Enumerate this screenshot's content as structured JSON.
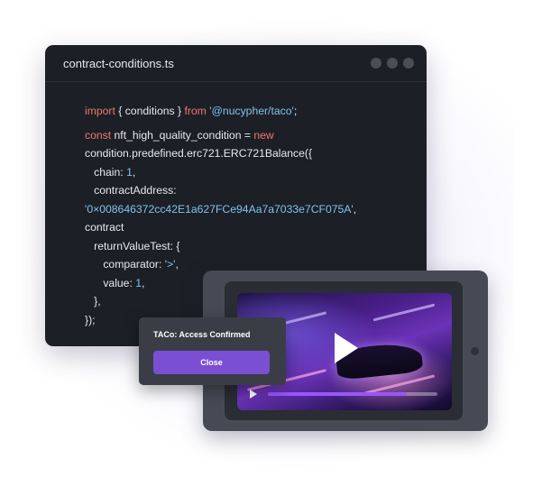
{
  "editor": {
    "file_name": "contract-conditions.ts",
    "lines": [
      [
        {
          "t": "import",
          "c": "kw"
        },
        {
          "t": " { conditions } ",
          "c": ""
        },
        {
          "t": "from",
          "c": "kw"
        },
        {
          "t": " ",
          "c": ""
        },
        {
          "t": "'@nucypher/taco'",
          "c": "str"
        },
        {
          "t": ";",
          "c": ""
        }
      ],
      [
        {
          "t": "const",
          "c": "kw"
        },
        {
          "t": " nft_high_quality_condition = ",
          "c": ""
        },
        {
          "t": "new",
          "c": "kw"
        }
      ],
      [
        {
          "t": "condition.predefined.erc721.ERC721Balance({",
          "c": ""
        }
      ],
      [
        {
          "t": "   chain: ",
          "c": ""
        },
        {
          "t": "1",
          "c": "num"
        },
        {
          "t": ",",
          "c": ""
        }
      ],
      [
        {
          "t": "   contractAddress:",
          "c": ""
        }
      ],
      [
        {
          "t": "'0×008646372cc42E1a627FCe94Aa7a7033e7CF075A'",
          "c": "str"
        },
        {
          "t": ",",
          "c": ""
        }
      ],
      [
        {
          "t": "contract",
          "c": ""
        }
      ],
      [
        {
          "t": "   returnValueTest: {",
          "c": ""
        }
      ],
      [
        {
          "t": "      comparator: ",
          "c": ""
        },
        {
          "t": "'>'",
          "c": "str"
        },
        {
          "t": ",",
          "c": ""
        }
      ],
      [
        {
          "t": "      value: ",
          "c": ""
        },
        {
          "t": "1",
          "c": "num"
        },
        {
          "t": ",",
          "c": ""
        }
      ],
      [
        {
          "t": "   },",
          "c": ""
        }
      ],
      [
        {
          "t": "});",
          "c": ""
        }
      ]
    ]
  },
  "video": {
    "progress": 0.82
  },
  "dialog": {
    "title": "TACo: Access Confirmed",
    "close_label": "Close"
  },
  "colors": {
    "keyword": "#f0766d",
    "string": "#7fc4ee",
    "accent": "#7b4fd3"
  },
  "icons": [
    "window-dot-icon",
    "play-icon",
    "play-small-icon"
  ]
}
